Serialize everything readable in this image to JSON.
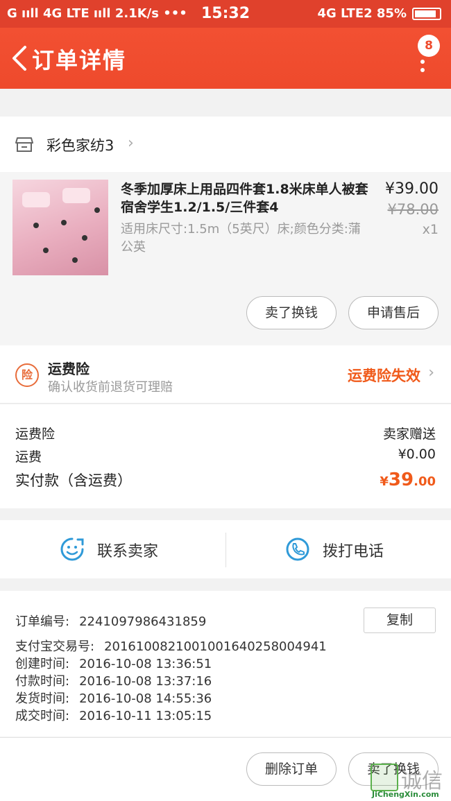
{
  "status_bar": {
    "left": "G ııll 4G LTE ııll 2.1K/s •••",
    "time": "15:32",
    "right": "4G LTE2 85%"
  },
  "header": {
    "title": "订单详情",
    "badge_count": "8"
  },
  "shop": {
    "name": "彩色家纺3"
  },
  "product": {
    "title": "冬季加厚床上用品四件套1.8米床单人被套宿舍学生1.2/1.5/三件套4",
    "spec": "适用床尺寸:1.5m（5英尺）床;颜色分类:蒲公英",
    "price": "¥39.00",
    "original_price": "¥78.00",
    "quantity": "x1",
    "buttons": [
      "卖了换钱",
      "申请售后"
    ]
  },
  "insurance": {
    "icon_char": "险",
    "title": "运费险",
    "subtitle": "确认收货前退货可理赔",
    "status": "运费险失效"
  },
  "fees": {
    "rows": [
      {
        "label": "运费险",
        "value": "卖家赠送"
      },
      {
        "label": "运费",
        "value": "¥0.00"
      }
    ],
    "total_label": "实付款（含运费）",
    "total_currency": "¥",
    "total_int": "39",
    "total_dec": ".00"
  },
  "contact": {
    "seller": "联系卖家",
    "phone": "拨打电话"
  },
  "order_info": {
    "copy_label": "复制",
    "rows": [
      {
        "key": "订单编号:",
        "value": "2241097986431859"
      },
      {
        "key": "支付宝交易号:",
        "value": "2016100821001001640258004941"
      },
      {
        "key": "创建时间:",
        "value": "2016-10-08 13:36:51"
      },
      {
        "key": "付款时间:",
        "value": "2016-10-08 13:37:16"
      },
      {
        "key": "发货时间:",
        "value": "2016-10-08 14:55:36"
      },
      {
        "key": "成交时间:",
        "value": "2016-10-11 13:05:15"
      }
    ]
  },
  "bottom_bar": {
    "buttons": [
      "删除订单",
      "卖了换钱"
    ]
  },
  "watermark": {
    "text": "诚信",
    "url": "JiChengXin.com"
  },
  "colors": {
    "brand": "#ee4a2c",
    "accent_orange": "#f05a1a",
    "contact_blue": "#2f9ad8"
  }
}
